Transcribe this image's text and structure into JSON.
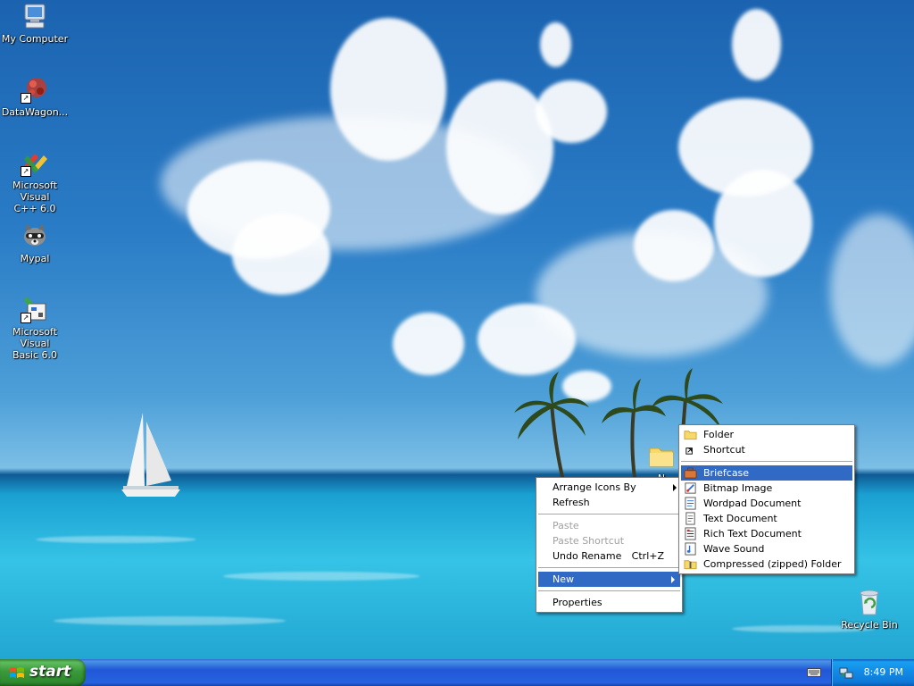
{
  "desktop": {
    "icons": [
      {
        "label": "My Computer"
      },
      {
        "label": "DataWagon..."
      },
      {
        "label": "Microsoft Visual\nC++ 6.0"
      },
      {
        "label": "Mypal"
      },
      {
        "label": "Microsoft Visual\nBasic 6.0"
      },
      {
        "label": "Recycle Bin"
      }
    ],
    "new_folder_label": "N"
  },
  "context_menu": {
    "items": [
      {
        "label": "Arrange Icons By"
      },
      {
        "label": "Refresh"
      },
      {
        "label": "Paste"
      },
      {
        "label": "Paste Shortcut"
      },
      {
        "label": "Undo Rename",
        "shortcut": "Ctrl+Z"
      },
      {
        "label": "New"
      },
      {
        "label": "Properties"
      }
    ]
  },
  "new_submenu": {
    "items": [
      {
        "label": "Folder"
      },
      {
        "label": "Shortcut"
      },
      {
        "label": "Briefcase"
      },
      {
        "label": "Bitmap Image"
      },
      {
        "label": "Wordpad Document"
      },
      {
        "label": "Text Document"
      },
      {
        "label": "Rich Text Document"
      },
      {
        "label": "Wave Sound"
      },
      {
        "label": "Compressed (zipped) Folder"
      }
    ]
  },
  "taskbar": {
    "start_label": "start",
    "clock": "8:49 PM"
  },
  "colors": {
    "menu_highlight": "#316ac5",
    "taskbar_blue": "#2457d4",
    "start_green": "#3a9a3a"
  }
}
